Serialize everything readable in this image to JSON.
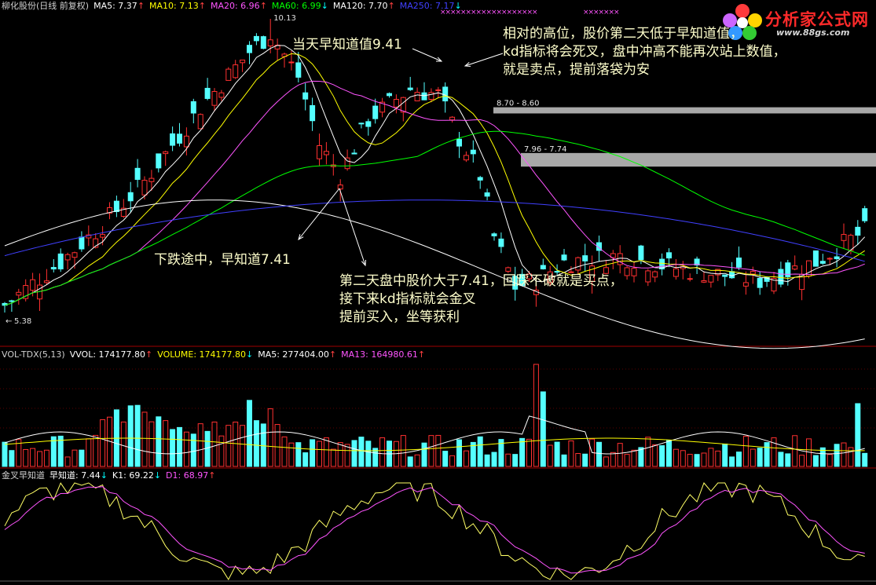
{
  "header_main": {
    "title": "柳化股份(日线 前复权)",
    "items": [
      {
        "text": "MA5: 7.37",
        "color": "#ffffff",
        "arrow": "↑",
        "arrow_color": "#ff4040"
      },
      {
        "text": "MA10: 7.13",
        "color": "#ffff00",
        "arrow": "↑",
        "arrow_color": "#ff4040"
      },
      {
        "text": "MA20: 6.96",
        "color": "#ff55ff",
        "arrow": "↑",
        "arrow_color": "#ff4040"
      },
      {
        "text": "MA60: 6.99",
        "color": "#00ff00",
        "arrow": "↓",
        "arrow_color": "#00ffff"
      },
      {
        "text": "MA120: 7.70",
        "color": "#ffffff",
        "arrow": "↑",
        "arrow_color": "#ff4040"
      },
      {
        "text": "MA250: 7.17",
        "color": "#4040ff",
        "arrow": "↓",
        "arrow_color": "#00ffff"
      }
    ]
  },
  "header_vol": {
    "title": "VOL-TDX(5,13)",
    "items": [
      {
        "text": "VVOL: 174177.80",
        "color": "#ffffff",
        "arrow": "↑",
        "arrow_color": "#ff4040"
      },
      {
        "text": "VOLUME: 174177.80",
        "color": "#ffff00",
        "arrow": "↓",
        "arrow_color": "#00ffff"
      },
      {
        "text": "MA5: 277404.00",
        "color": "#ffffff",
        "arrow": "↑",
        "arrow_color": "#ff4040"
      },
      {
        "text": "MA13: 164980.61",
        "color": "#ff55ff",
        "arrow": "↑",
        "arrow_color": "#ff4040"
      }
    ]
  },
  "header_kd": {
    "title": "金叉早知道",
    "items": [
      {
        "text": "早知道: 7.44",
        "color": "#ffffff",
        "arrow": "↓",
        "arrow_color": "#00ffff"
      },
      {
        "text": "K1: 69.22",
        "color": "#ffffff",
        "arrow": "↓",
        "arrow_color": "#00ffff"
      },
      {
        "text": "D1: 68.97",
        "color": "#ff55ff",
        "arrow": "↑",
        "arrow_color": "#ff4040"
      }
    ]
  },
  "logo": {
    "name": "分析家公式网",
    "url": "www.88gs.com"
  },
  "annotations": {
    "a1": [
      "当天早知道值9.41"
    ],
    "a2": [
      "相对的高位，股价第二天低于早知道值，",
      "kd指标将会死叉，盘中冲高不能再次站上数值，",
      "就是卖点，提前落袋为安"
    ],
    "a3": [
      "下跌途中，早知道7.41"
    ],
    "a4": [
      "第二天盘中股价大于7.41，回踩不破就是买点，",
      "接下来kd指标就会金叉",
      "提前买入，坐等获利"
    ]
  },
  "chart_data": [
    {
      "type": "candlestick",
      "title": "柳化股份(日线 前复权)",
      "y_range": [
        5.38,
        10.13
      ],
      "high_label": "10.13",
      "low_label": "5.38",
      "price_levels": [
        {
          "label": "8.70 - 8.60",
          "from": 8.7,
          "to": 8.6
        },
        {
          "label": "7.96 - 7.74",
          "from": 7.96,
          "to": 7.74
        }
      ],
      "series": [
        {
          "name": "MA5",
          "color": "#ffffff"
        },
        {
          "name": "MA10",
          "color": "#ffff00"
        },
        {
          "name": "MA20",
          "color": "#ff55ff"
        },
        {
          "name": "MA60",
          "color": "#00ff00"
        },
        {
          "name": "MA120",
          "color": "#ffffff"
        },
        {
          "name": "MA250",
          "color": "#4040ff"
        }
      ],
      "up_color": "#ff3030",
      "down_color": "#54ffff"
    },
    {
      "type": "bar",
      "title": "VOL-TDX(5,13)",
      "series": [
        {
          "name": "VVOL",
          "color": "#ffffff"
        },
        {
          "name": "MA5",
          "color": "#ffffff"
        },
        {
          "name": "MA13",
          "color": "#ff55ff"
        }
      ]
    },
    {
      "type": "line",
      "title": "金叉早知道",
      "series": [
        {
          "name": "K1",
          "color": "#ffff66"
        },
        {
          "name": "D1",
          "color": "#ff55ff"
        }
      ]
    }
  ]
}
